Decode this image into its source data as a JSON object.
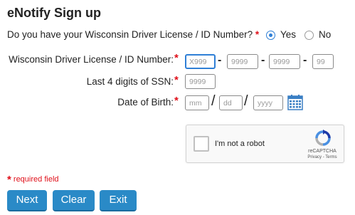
{
  "page": {
    "title": "eNotify Sign up"
  },
  "question": {
    "text": "Do you have your Wisconsin Driver License / ID Number?",
    "required_mark": "*",
    "options": [
      {
        "label": "Yes",
        "selected": true
      },
      {
        "label": "No",
        "selected": false
      }
    ]
  },
  "form": {
    "license": {
      "label": "Wisconsin Driver License / ID Number:",
      "required_mark": "*",
      "parts": [
        {
          "placeholder": "X999"
        },
        {
          "placeholder": "9999"
        },
        {
          "placeholder": "9999"
        },
        {
          "placeholder": "99"
        }
      ],
      "separator": "-"
    },
    "ssn": {
      "label": "Last 4 digits of SSN:",
      "required_mark": "*",
      "placeholder": "9999"
    },
    "dob": {
      "label": "Date of Birth:",
      "required_mark": "*",
      "month_placeholder": "mm",
      "day_placeholder": "dd",
      "year_placeholder": "yyyy",
      "separator": "/",
      "icon": "calendar-icon"
    }
  },
  "captcha": {
    "label": "I'm not a robot",
    "brand": "reCAPTCHA",
    "privacy": "Privacy",
    "terms_separator": " - ",
    "terms": "Terms",
    "icon": "recaptcha-logo-icon"
  },
  "required_note": {
    "mark": "*",
    "text": "required field"
  },
  "buttons": {
    "next": "Next",
    "clear": "Clear",
    "exit": "Exit"
  },
  "colors": {
    "accent": "#2a8ac7",
    "required": "#e0101a",
    "focus": "#2f7fd6"
  }
}
